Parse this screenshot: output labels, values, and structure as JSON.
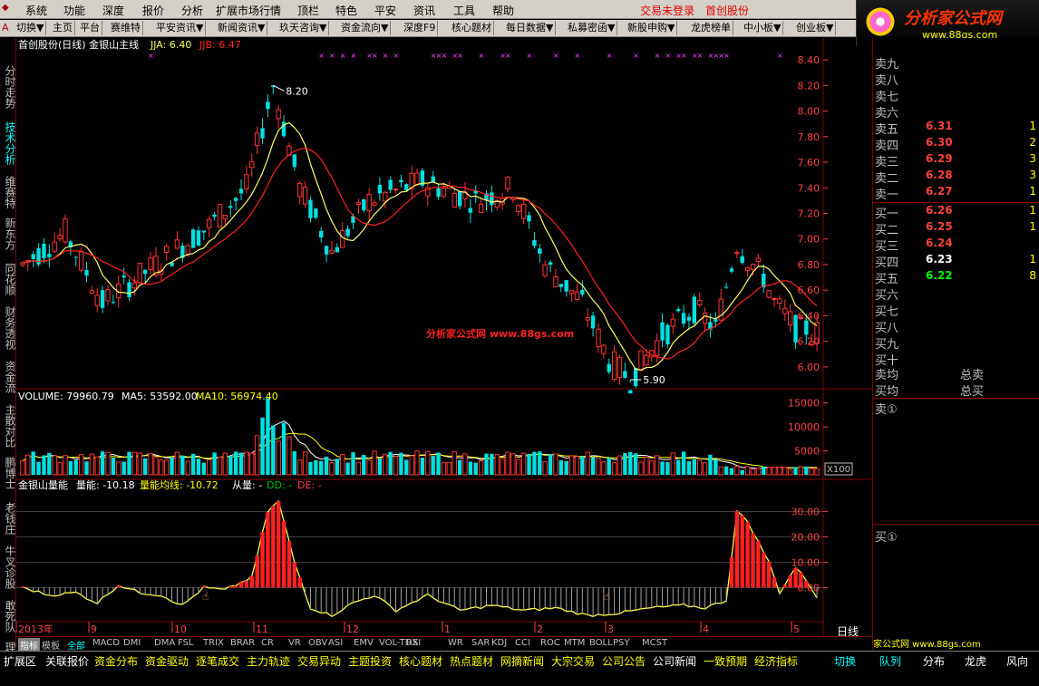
{
  "menu": {
    "items": [
      "系统",
      "功能",
      "深度",
      "报价",
      "分析",
      "扩展市场行情",
      "顶栏",
      "特色",
      "平安",
      "资讯",
      "工具",
      "帮助"
    ],
    "warning": "交易未登录",
    "stock_link": "首创股份"
  },
  "logo": {
    "text": "分析家公式网",
    "url": "www.88gs.com"
  },
  "toolbar": {
    "items": [
      "切换▼",
      "主页",
      "平台",
      "赛维特",
      "平安资讯▼",
      "新闻资讯▼",
      "玖天咨询▼",
      "资金流向▼",
      "深度F9",
      "核心题材",
      "每日数据▼",
      "私募密函▼",
      "新股申购▼",
      "龙虎榜单",
      "中小板▼",
      "创业板▼"
    ]
  },
  "sidenav": {
    "items": [
      "分时走势",
      "技术分析",
      "维赛特",
      "新东方",
      "同花顺",
      "财务透视",
      "资金流",
      "主散对比",
      "鹏博士",
      "老钱庄",
      "牛叉诊股",
      "敢死队",
      "理"
    ]
  },
  "main_chart": {
    "title": "首创股份(日线) 金银山主线",
    "jja": "JJA: 6.40",
    "jjb": "JJB: 6.47",
    "high_label": "8.20",
    "low_label": "5.90",
    "watermark": "分析家公式网 www.88gs.com"
  },
  "volume_chart": {
    "label": "VOLUME: 79960.79",
    "ma5": "MA5: 53592.00",
    "ma10": "MA10: 56974.40",
    "unit": "X100"
  },
  "indicator_chart": {
    "name": "金银山量能",
    "lineng": "量能: -10.18",
    "avg": "量能均线: -10.72",
    "cong": "从量: -",
    "dd": "DD: -",
    "de": "DE: -"
  },
  "chart_data": [
    {
      "type": "candlestick",
      "title": "首创股份(日线) 金银山主线",
      "ylim": [
        5.9,
        8.5
      ],
      "yticks": [
        "8.40",
        "8.20",
        "8.00",
        "7.80",
        "7.60",
        "7.40",
        "7.20",
        "7.00",
        "6.80",
        "6.60",
        "6.40",
        "6.20",
        "6.00"
      ],
      "x_months": [
        "2013年",
        "9",
        "10",
        "11",
        "12",
        "1",
        "2",
        "3",
        "4",
        "5"
      ],
      "series": [
        {
          "name": "JJA",
          "last": 6.4
        },
        {
          "name": "JJB",
          "last": 6.47
        }
      ],
      "annotations": [
        {
          "text": "8.20",
          "value": 8.2
        },
        {
          "text": "5.90",
          "value": 5.9
        }
      ]
    },
    {
      "type": "bar",
      "title": "VOLUME",
      "ylim": [
        0,
        17000
      ],
      "yticks": [
        "15000",
        "10000",
        "5000"
      ]
    },
    {
      "type": "bar",
      "title": "金银山量能",
      "ylim": [
        -12,
        38
      ],
      "yticks": [
        "30.00",
        "20.00",
        "10.00",
        "0.00"
      ]
    }
  ],
  "orderbook": {
    "rows": [
      {
        "label": "卖九",
        "price": "",
        "vol": "",
        "color": "#ff4040"
      },
      {
        "label": "卖八",
        "price": "",
        "vol": "",
        "color": "#ff4040"
      },
      {
        "label": "卖七",
        "price": "",
        "vol": "",
        "color": "#ff4040"
      },
      {
        "label": "卖六",
        "price": "",
        "vol": "",
        "color": "#ff4040"
      },
      {
        "label": "卖五",
        "price": "6.31",
        "vol": "1",
        "color": "#ff4040"
      },
      {
        "label": "卖四",
        "price": "6.30",
        "vol": "2",
        "color": "#ff4040"
      },
      {
        "label": "卖三",
        "price": "6.29",
        "vol": "3",
        "color": "#ff4040"
      },
      {
        "label": "卖二",
        "price": "6.28",
        "vol": "3",
        "color": "#ff4040"
      },
      {
        "label": "卖一",
        "price": "6.27",
        "vol": "1",
        "color": "#ff4040"
      },
      {
        "label": "买一",
        "price": "6.26",
        "vol": "1",
        "color": "#ff4040"
      },
      {
        "label": "买二",
        "price": "6.25",
        "vol": "1",
        "color": "#ff4040"
      },
      {
        "label": "买三",
        "price": "6.24",
        "vol": "",
        "color": "#ff4040"
      },
      {
        "label": "买四",
        "price": "6.23",
        "vol": "1",
        "color": "#ffffff"
      },
      {
        "label": "买五",
        "price": "6.22",
        "vol": "8",
        "color": "#00ff00"
      },
      {
        "label": "买六",
        "price": "",
        "vol": "",
        "color": "#ff4040"
      },
      {
        "label": "买七",
        "price": "",
        "vol": "",
        "color": "#ff4040"
      },
      {
        "label": "买八",
        "price": "",
        "vol": "",
        "color": "#ff4040"
      },
      {
        "label": "买九",
        "price": "",
        "vol": "",
        "color": "#ff4040"
      },
      {
        "label": "买十",
        "price": "",
        "vol": "",
        "color": "#ff4040"
      }
    ],
    "sell_avg": "卖均",
    "buy_avg": "买均",
    "total_sell": "总卖",
    "total_buy": "总买",
    "sell_queue": "卖①",
    "buy_queue": "买①"
  },
  "period_label": "日线",
  "tabstrip": {
    "items": [
      "指标",
      "模板",
      "全部",
      "MACD",
      "DMI",
      "DMA",
      "FSL",
      "TRIX",
      "BRAR",
      "CR",
      "VR",
      "OBV",
      "ASI",
      "EMV",
      "VOL-TDX",
      "RSI",
      "WR",
      "SAR",
      "KDJ",
      "CCI",
      "ROC",
      "MTM",
      "BOLL",
      "PSY",
      "MCST"
    ]
  },
  "bottombar": {
    "left": [
      "扩展区",
      "关联报价"
    ],
    "items": [
      "资金分布",
      "资金驱动",
      "逐笔成交",
      "主力轨迹",
      "交易异动",
      "主题投资",
      "核心题材",
      "热点题材",
      "网摘新闻",
      "大宗交易",
      "公司公告",
      "公司新闻",
      "一致预期",
      "经济指标"
    ],
    "right": [
      "切换",
      "队列",
      "分布",
      "龙虎",
      "风向"
    ]
  },
  "colors": {
    "up": "#ff3232",
    "down": "#00e0e0",
    "jja": "#ffff64",
    "jjb": "#ff2020",
    "grid": "#800000",
    "axis": "#ff4040"
  }
}
